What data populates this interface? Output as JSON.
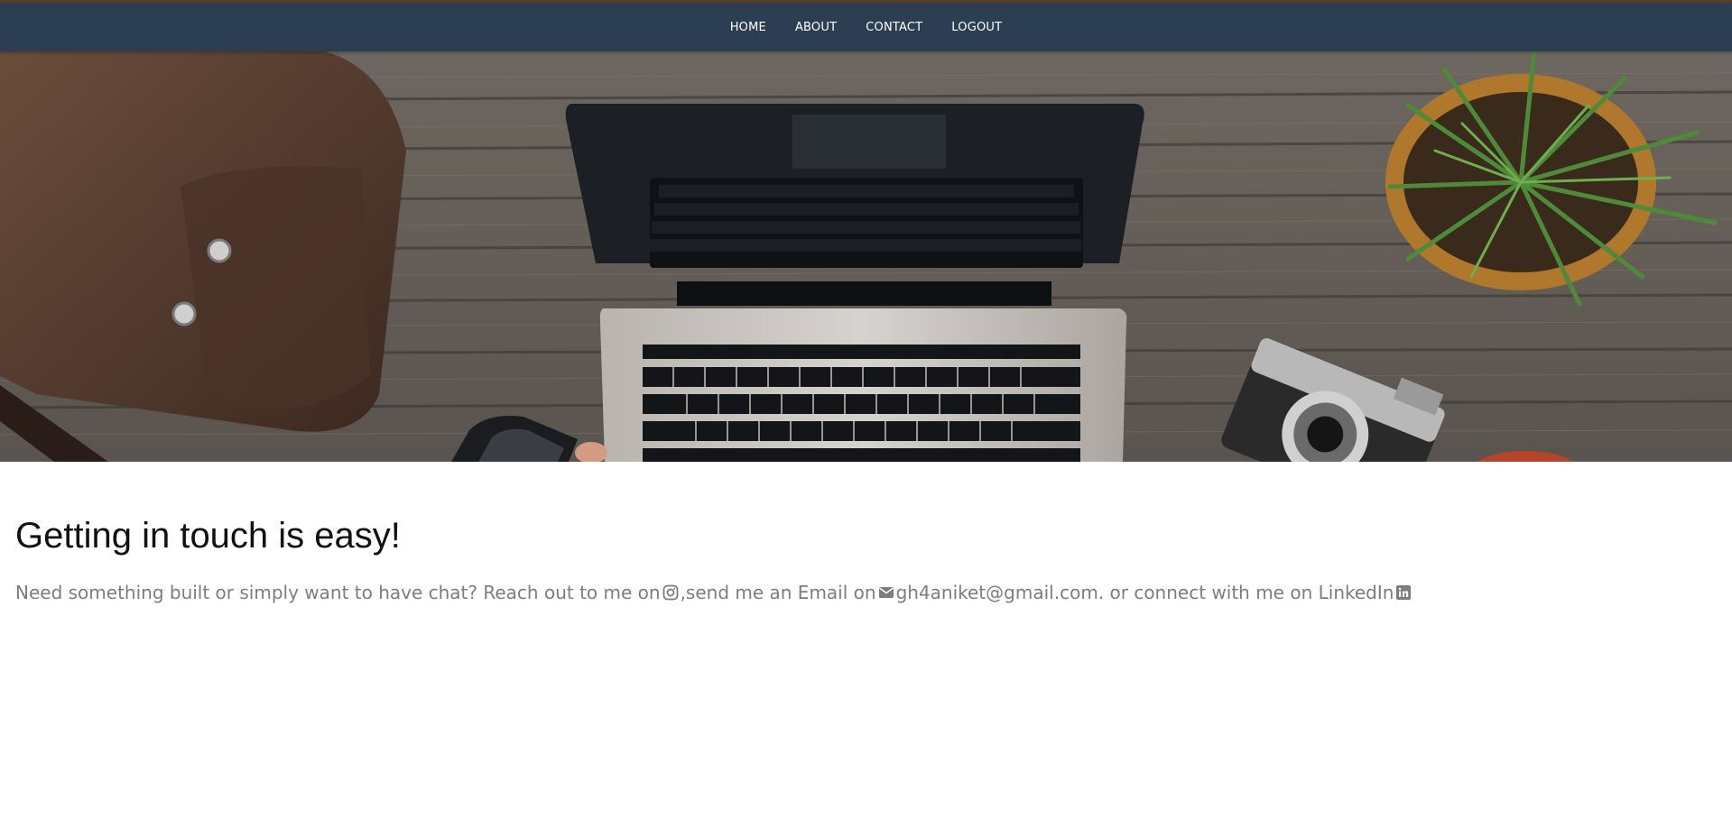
{
  "nav": {
    "items": [
      {
        "label": "HOME"
      },
      {
        "label": "ABOUT"
      },
      {
        "label": "CONTACT"
      },
      {
        "label": "LOGOUT"
      }
    ]
  },
  "hero": {
    "image": "desk-with-laptop-bag-camera-plant"
  },
  "contact": {
    "heading": "Getting in touch is easy!",
    "text_1": "Need something built or simply want to have chat? Reach out to me on ",
    "text_2": ",send me an Email on",
    "email": "gh4aniket@gmail.com",
    "text_3": ". or connect with me on LinkedIn",
    "icons": {
      "instagram": "instagram-icon",
      "email": "email-icon",
      "linkedin": "linkedin-icon"
    }
  },
  "colors": {
    "navbar": "#2c3e52",
    "heading": "#111111",
    "body_text": "#7d7d7d"
  }
}
